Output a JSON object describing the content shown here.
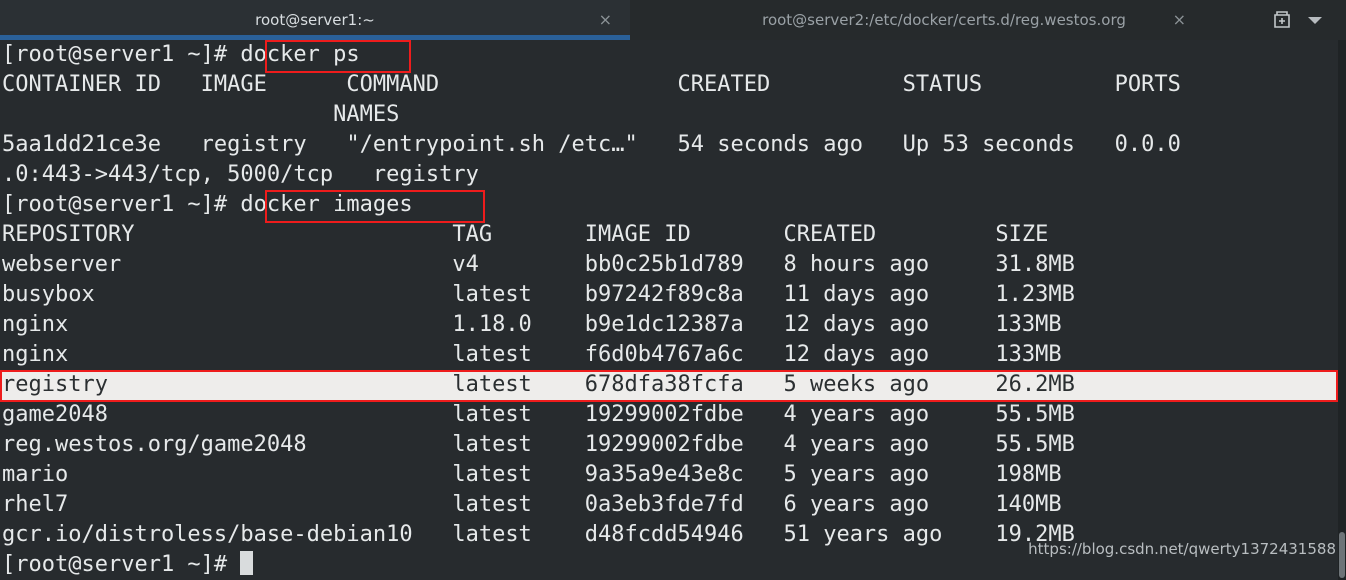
{
  "window": {
    "tabs": [
      {
        "title": "root@server1:~",
        "active": true,
        "close_label": "×"
      },
      {
        "title": "root@server2:/etc/docker/certs.d/reg.westos.org",
        "active": false,
        "close_label": "×"
      }
    ],
    "new_tab_icon": "new-tab-icon",
    "menu_icon": "chevron-down-icon"
  },
  "colors": {
    "terminal_bg": "#272b2e",
    "terminal_fg": "#e6e9ea",
    "tab_active_bg": "#2b3034",
    "tab_accent": "#2a6099",
    "selection_bg": "#eeedeb",
    "selection_fg": "#2b2f31",
    "annotation": "#ee1c1c"
  },
  "terminal": {
    "prompt": "[root@server1 ~]# ",
    "lines": [
      {
        "text": "[root@server1 ~]# docker ps",
        "selected": false
      },
      {
        "text": "CONTAINER ID   IMAGE      COMMAND                  CREATED          STATUS          PORTS",
        "selected": false
      },
      {
        "text": "                         NAMES",
        "selected": false
      },
      {
        "text": "5aa1dd21ce3e   registry   \"/entrypoint.sh /etc…\"   54 seconds ago   Up 53 seconds   0.0.0",
        "selected": false
      },
      {
        "text": ".0:443->443/tcp, 5000/tcp   registry",
        "selected": false
      },
      {
        "text": "[root@server1 ~]# docker images",
        "selected": false
      },
      {
        "text": "REPOSITORY                        TAG       IMAGE ID       CREATED         SIZE",
        "selected": false
      },
      {
        "text": "webserver                         v4        bb0c25b1d789   8 hours ago     31.8MB",
        "selected": false
      },
      {
        "text": "busybox                           latest    b97242f89c8a   11 days ago     1.23MB",
        "selected": false
      },
      {
        "text": "nginx                             1.18.0    b9e1dc12387a   12 days ago     133MB",
        "selected": false
      },
      {
        "text": "nginx                             latest    f6d0b4767a6c   12 days ago     133MB",
        "selected": false
      },
      {
        "text": "registry                          latest    678dfa38fcfa   5 weeks ago     26.2MB",
        "selected": true
      },
      {
        "text": "game2048                          latest    19299002fdbe   4 years ago     55.5MB",
        "selected": false
      },
      {
        "text": "reg.westos.org/game2048           latest    19299002fdbe   4 years ago     55.5MB",
        "selected": false
      },
      {
        "text": "mario                             latest    9a35a9e43e8c   5 years ago     198MB",
        "selected": false
      },
      {
        "text": "rhel7                             latest    0a3eb3fde7fd   6 years ago     140MB",
        "selected": false
      },
      {
        "text": "gcr.io/distroless/base-debian10   latest    d48fcdd54946   51 years ago    19.2MB",
        "selected": false
      },
      {
        "text": "[root@server1 ~]# ",
        "selected": false,
        "cursor": true
      }
    ],
    "commands_highlighted": [
      "docker ps",
      "docker images"
    ],
    "highlighted_row": "registry                          latest    678dfa38fcfa   5 weeks ago     26.2MB"
  },
  "docker_ps": {
    "headers": [
      "CONTAINER ID",
      "IMAGE",
      "COMMAND",
      "CREATED",
      "STATUS",
      "PORTS",
      "NAMES"
    ],
    "rows": [
      {
        "container_id": "5aa1dd21ce3e",
        "image": "registry",
        "command": "\"/entrypoint.sh /etc…\"",
        "created": "54 seconds ago",
        "status": "Up 53 seconds",
        "ports": "0.0.0.0:443->443/tcp, 5000/tcp",
        "names": "registry"
      }
    ]
  },
  "docker_images": {
    "headers": [
      "REPOSITORY",
      "TAG",
      "IMAGE ID",
      "CREATED",
      "SIZE"
    ],
    "rows": [
      {
        "repository": "webserver",
        "tag": "v4",
        "image_id": "bb0c25b1d789",
        "created": "8 hours ago",
        "size": "31.8MB"
      },
      {
        "repository": "busybox",
        "tag": "latest",
        "image_id": "b97242f89c8a",
        "created": "11 days ago",
        "size": "1.23MB"
      },
      {
        "repository": "nginx",
        "tag": "1.18.0",
        "image_id": "b9e1dc12387a",
        "created": "12 days ago",
        "size": "133MB"
      },
      {
        "repository": "nginx",
        "tag": "latest",
        "image_id": "f6d0b4767a6c",
        "created": "12 days ago",
        "size": "133MB"
      },
      {
        "repository": "registry",
        "tag": "latest",
        "image_id": "678dfa38fcfa",
        "created": "5 weeks ago",
        "size": "26.2MB"
      },
      {
        "repository": "game2048",
        "tag": "latest",
        "image_id": "19299002fdbe",
        "created": "4 years ago",
        "size": "55.5MB"
      },
      {
        "repository": "reg.westos.org/game2048",
        "tag": "latest",
        "image_id": "19299002fdbe",
        "created": "4 years ago",
        "size": "55.5MB"
      },
      {
        "repository": "mario",
        "tag": "latest",
        "image_id": "9a35a9e43e8c",
        "created": "5 years ago",
        "size": "198MB"
      },
      {
        "repository": "rhel7",
        "tag": "latest",
        "image_id": "0a3eb3fde7fd",
        "created": "6 years ago",
        "size": "140MB"
      },
      {
        "repository": "gcr.io/distroless/base-debian10",
        "tag": "latest",
        "image_id": "d48fcdd54946",
        "created": "51 years ago",
        "size": "19.2MB"
      }
    ]
  },
  "watermark": {
    "text": "https://blog.csdn.net/qwerty1372431588"
  }
}
